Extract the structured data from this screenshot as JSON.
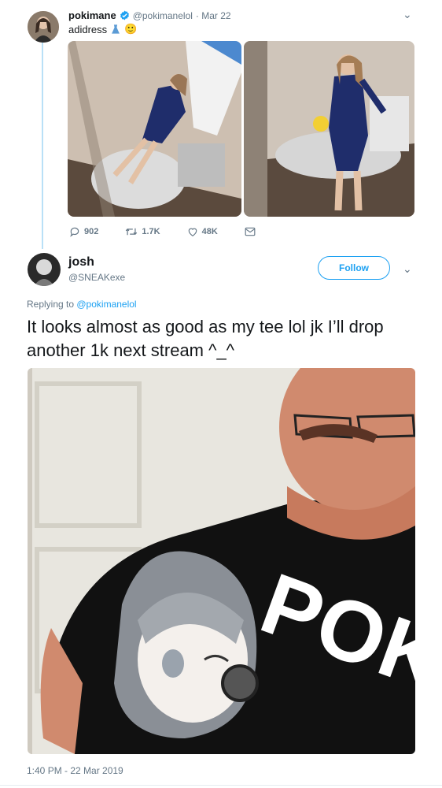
{
  "tweet": {
    "author_name": "pokimane",
    "author_handle": "@pokimanelol",
    "date": "· Mar 22",
    "text": "adidress",
    "emoji": "🙂",
    "actions": {
      "replies": "902",
      "retweets": "1.7K",
      "likes": "48K"
    },
    "colors": {
      "verified": "#1da1f2",
      "dress": "#1f2d6b",
      "room": "#c9b9aa"
    }
  },
  "reply": {
    "author_name": "josh",
    "author_handle": "@SNEAKexe",
    "follow_label": "Follow",
    "replying_prefix": "Replying to ",
    "replying_handle": "@pokimanelol",
    "text": "It looks almost as good as my tee lol jk I’ll drop another 1k next stream ^_^",
    "photo_shirt_text": "POKI",
    "timestamp": "1:40 PM - 22 Mar 2019",
    "colors": {
      "accent": "#1da1f2",
      "shirt": "#111111",
      "door": "#e8e6df",
      "skin": "#d08a6e"
    }
  }
}
